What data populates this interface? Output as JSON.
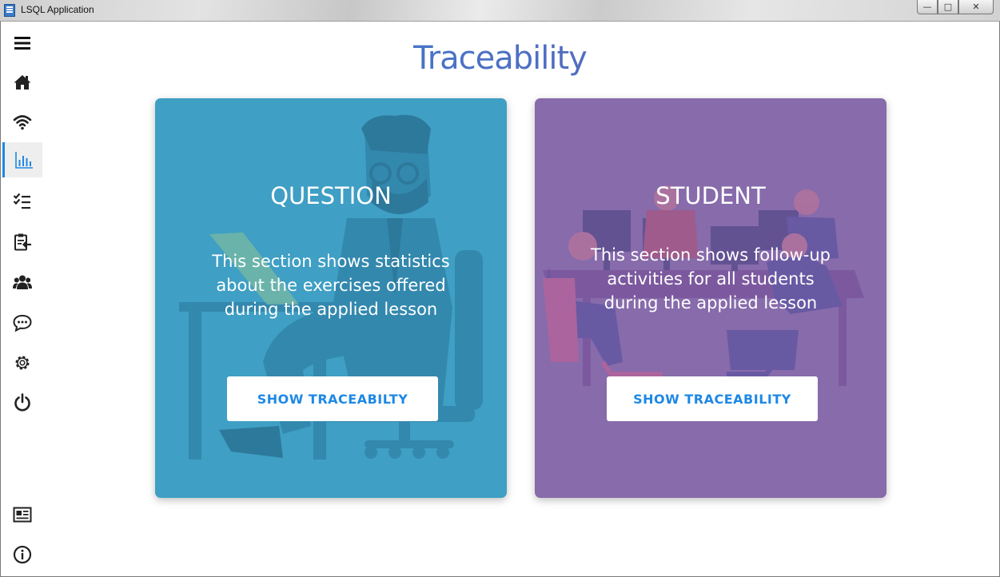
{
  "window": {
    "title": "LSQL Application",
    "controls": {
      "minimize": "—",
      "maximize": "□",
      "close": "✕"
    }
  },
  "sidebar": {
    "items": [
      {
        "name": "menu",
        "icon": "hamburger-menu-icon"
      },
      {
        "name": "home",
        "icon": "home-icon"
      },
      {
        "name": "network",
        "icon": "wifi-icon"
      },
      {
        "name": "statistics",
        "icon": "bar-chart-icon",
        "active": true
      },
      {
        "name": "checklist",
        "icon": "checklist-icon"
      },
      {
        "name": "assignments",
        "icon": "clipboard-icon"
      },
      {
        "name": "users",
        "icon": "users-group-icon"
      },
      {
        "name": "chat",
        "icon": "chat-bubble-icon"
      },
      {
        "name": "settings",
        "icon": "gear-icon"
      },
      {
        "name": "logout",
        "icon": "power-icon"
      }
    ],
    "bottom_items": [
      {
        "name": "news",
        "icon": "newspaper-icon"
      },
      {
        "name": "info",
        "icon": "info-icon"
      }
    ],
    "active_color": "#1e88e5"
  },
  "main": {
    "title": "Traceability",
    "cards": [
      {
        "id": "question",
        "heading": "QUESTION",
        "description": "This section shows statistics about the exercises offered during the applied lesson",
        "button_label": "SHOW TRACEABILTY",
        "color": "#3f9fc4"
      },
      {
        "id": "student",
        "heading": "STUDENT",
        "description": "This section shows follow-up activities for all students during the applied lesson",
        "button_label": "SHOW TRACEABILITY",
        "color": "#876bab"
      }
    ]
  }
}
